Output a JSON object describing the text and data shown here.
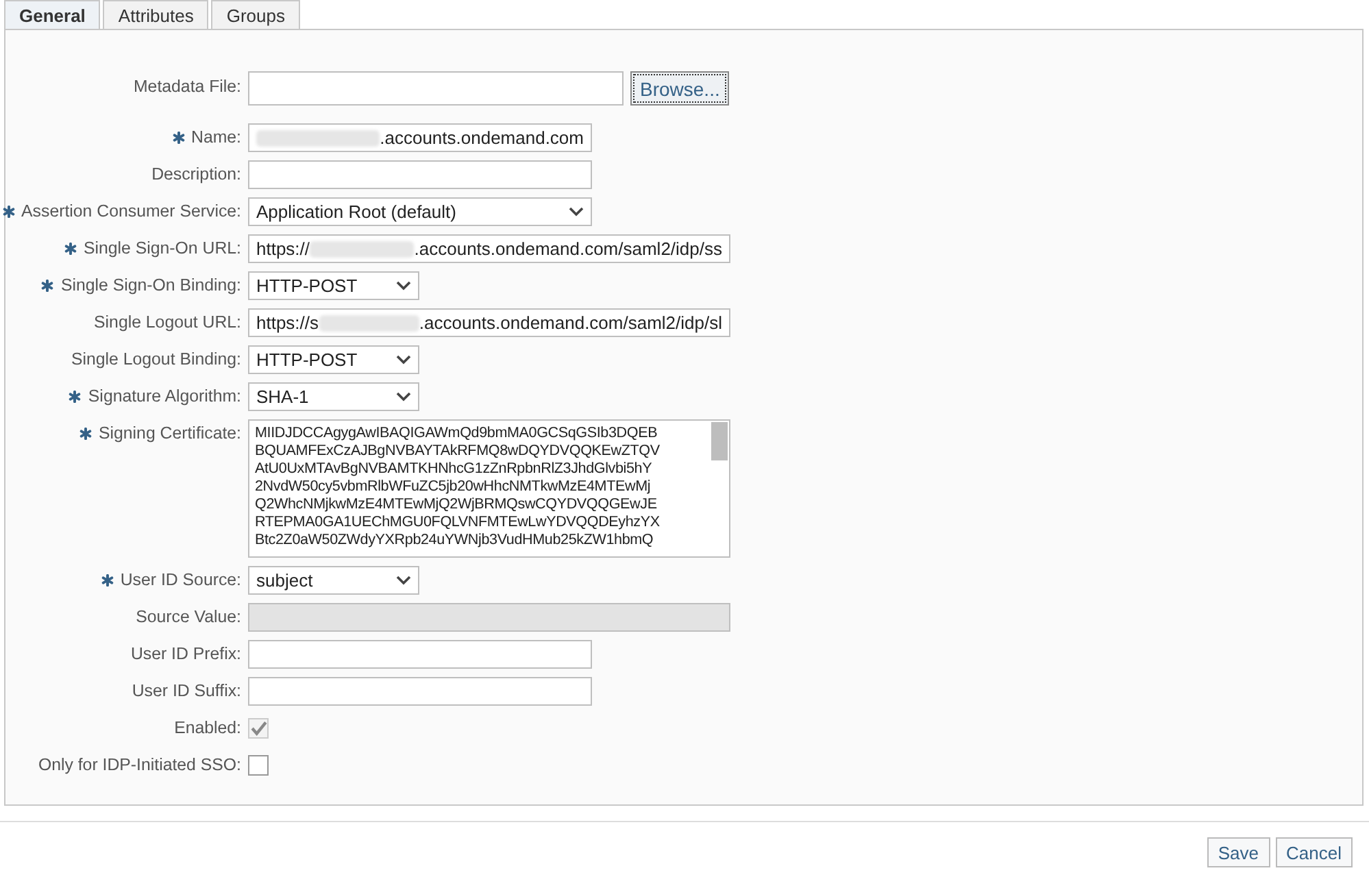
{
  "tabs": [
    {
      "label": "General",
      "selected": true
    },
    {
      "label": "Attributes",
      "selected": false
    },
    {
      "label": "Groups",
      "selected": false
    }
  ],
  "fields": [
    {
      "kind": "file",
      "label": "Metadata File:",
      "required": false,
      "button": "Browse..."
    },
    {
      "kind": "text",
      "label": "Name:",
      "required": true,
      "redacted": true,
      "value": ".accounts.ondemand.com"
    },
    {
      "kind": "text",
      "label": "Description:",
      "required": false
    },
    {
      "kind": "combo",
      "label": "Assertion Consumer Service:",
      "required": true,
      "value": "Application Root (default)"
    },
    {
      "kind": "url",
      "label": "Single Sign-On URL:",
      "required": true,
      "value_before": "https://",
      "redacted": true,
      "value": ".accounts.ondemand.com/saml2/idp/ss"
    },
    {
      "kind": "select",
      "label": "Single Sign-On Binding:",
      "required": true,
      "value": "HTTP-POST"
    },
    {
      "kind": "url",
      "label": "Single Logout URL:",
      "required": false,
      "value_before": "https://s",
      "redacted": true,
      "value": ".accounts.ondemand.com/saml2/idp/sl"
    },
    {
      "kind": "select",
      "label": "Single Logout Binding:",
      "required": false,
      "value": "HTTP-POST"
    },
    {
      "kind": "select",
      "label": "Signature Algorithm:",
      "required": true,
      "value": "SHA-1"
    },
    {
      "kind": "textarea",
      "label": "Signing Certificate:",
      "required": true,
      "lines": [
        "MIIDJDCCAgygAwIBAQIGAWmQd9bmMA0GCSqGSIb3DQEB",
        "BQUAMFExCzAJBgNVBAYTAkRFMQ8wDQYDVQQKEwZTQV",
        "AtU0UxMTAvBgNVBAMTKHNhcG1zZnRpbnRlZ3JhdGlvbi5hY",
        "2NvdW50cy5vbmRlbWFuZC5jb20wHhcNMTkwMzE4MTEwMj",
        "Q2WhcNMjkwMzE4MTEwMjQ2WjBRMQswCQYDVQQGEwJE",
        "RTEPMA0GA1UEChMGU0FQLVNFMTEwLwYDVQQDEyhzYX",
        "Btc2Z0aW50ZWdyYXRpb24uYWNjb3VudHMub25kZW1hbmQ"
      ]
    },
    {
      "kind": "select",
      "label": "User ID Source:",
      "required": true,
      "value": "subject"
    },
    {
      "kind": "url",
      "label": "Source Value:",
      "required": false,
      "disabled": true
    },
    {
      "kind": "text",
      "label": "User ID Prefix:",
      "required": false
    },
    {
      "kind": "text",
      "label": "User ID Suffix:",
      "required": false
    },
    {
      "kind": "checkbox",
      "label": "Enabled:",
      "required": false,
      "checked": true,
      "disabled": true
    },
    {
      "kind": "checkbox",
      "label": "Only for IDP-Initiated SSO:",
      "required": false,
      "checked": false,
      "disabled": false
    }
  ],
  "buttons": [
    "Save",
    "Cancel"
  ]
}
